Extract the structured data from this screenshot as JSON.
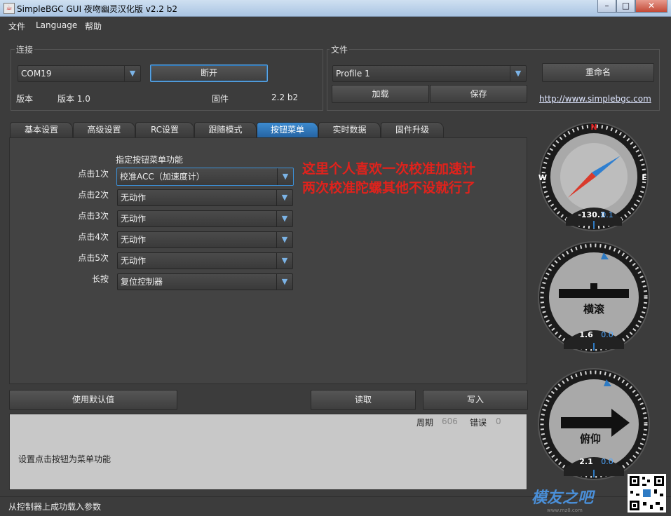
{
  "window": {
    "title": "SimpleBGC GUI 夜吻幽灵汉化版 v2.2 b2",
    "minimize": "–",
    "maximize": "□",
    "close": "✕"
  },
  "menu": [
    "文件",
    "Language",
    "帮助"
  ],
  "connection": {
    "group_label": "连接",
    "port": "COM19",
    "disconnect_label": "断开",
    "version_label": "版本",
    "version_value": "版本 1.0",
    "firmware_label": "固件",
    "firmware_value": "2.2 b2"
  },
  "file": {
    "group_label": "文件",
    "profile": "Profile 1",
    "rename_label": "重命名",
    "load_label": "加载",
    "save_label": "保存",
    "link": "http://www.simplebgc.com"
  },
  "tabs": [
    "基本设置",
    "高级设置",
    "RC设置",
    "跟随模式",
    "按钮菜单",
    "实时数据",
    "固件升级"
  ],
  "active_tab": "按钮菜单",
  "button_menu": {
    "header": "指定按钮菜单功能",
    "rows": [
      {
        "label": "点击1次",
        "value": "校准ACC（加速度计）"
      },
      {
        "label": "点击2次",
        "value": "无动作"
      },
      {
        "label": "点击3次",
        "value": "无动作"
      },
      {
        "label": "点击4次",
        "value": "无动作"
      },
      {
        "label": "点击5次",
        "value": "无动作"
      },
      {
        "label": "长按",
        "value": "复位控制器"
      }
    ]
  },
  "annotation": {
    "line1": "这里个人喜欢一次校准加速计",
    "line2": "两次校准陀螺其他不设就行了"
  },
  "actions": {
    "defaults_label": "使用默认值",
    "read_label": "读取",
    "write_label": "写入"
  },
  "console": {
    "cycle_label": "周期",
    "cycle_value": "606",
    "error_label": "错误",
    "error_value": "0",
    "message": "设置点击按钮为菜单功能"
  },
  "status": "从控制器上成功载入参数",
  "gauges": {
    "compass": {
      "n": "N",
      "w": "W",
      "e": "E",
      "value": "-130.1",
      "delta": "0.1"
    },
    "roll": {
      "label": "横滚",
      "value": "1.6",
      "delta": "0.0"
    },
    "pitch": {
      "label": "俯仰",
      "value": "2.1",
      "delta": "0.0"
    }
  },
  "watermark": {
    "text": "模友之吧",
    "url": "www.mz8.com"
  },
  "colors": {
    "accent": "#2e7bc4",
    "annotation": "#e0221c",
    "tab_active": "#2f78bd"
  }
}
